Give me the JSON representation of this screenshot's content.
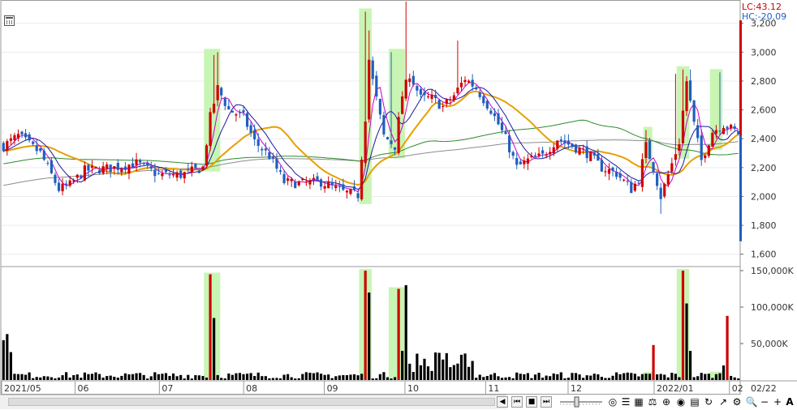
{
  "chart_data": {
    "type": "candlestick",
    "price_axis": {
      "ticks": [
        "3,200",
        "3,000",
        "2,800",
        "2,600",
        "2,400",
        "2,200",
        "2,000",
        "1,800",
        "1,600"
      ],
      "range": [
        1520,
        3350
      ]
    },
    "volume_axis": {
      "ticks": [
        "150,000K",
        "100,000K",
        "50,000K"
      ],
      "range": [
        0,
        150000
      ]
    },
    "x_labels": [
      "2021/05",
      "06",
      "07",
      "08",
      "09",
      "10",
      "11",
      "12",
      "2022/01",
      "02",
      "02/22"
    ],
    "lc_label": "LC:43.12",
    "hc_label": "HC:-20.09",
    "ranges": {
      "low": 1880,
      "high": 3350
    },
    "colors": {
      "up": "#d10000",
      "down": "#1f5fbf",
      "volume": "#000000",
      "volume_highlight": "#cc0000",
      "highlight": "#c8f5b4",
      "ma5": "#c800c8",
      "ma20": "#1a1aa0",
      "ma60": "#e6a000",
      "ma120": "#2e8b2e",
      "ma240": "#8c8c8c"
    }
  },
  "toolbar": {
    "buttons": [
      "prev-page",
      "prev",
      "stop",
      "next"
    ],
    "zoom_out": "−",
    "zoom_in": "+",
    "text_tool": "A"
  }
}
